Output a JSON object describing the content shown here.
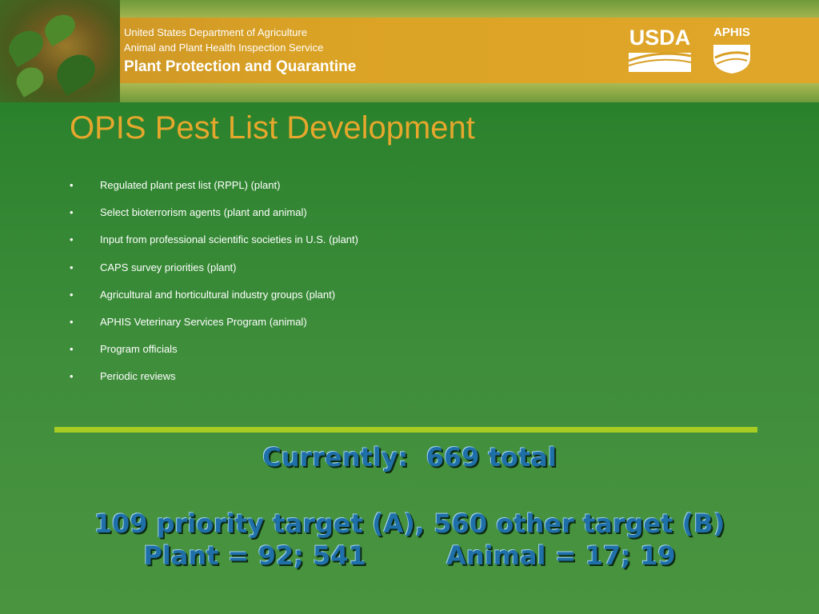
{
  "header": {
    "agency_line1": "United States Department of Agriculture",
    "agency_line2": "Animal and Plant Health Inspection Service",
    "program": "Plant Protection and Quarantine",
    "logo_usda": "USDA",
    "logo_aphis": "APHIS"
  },
  "slide": {
    "title": "OPIS Pest List Development",
    "bullet_marker": "•",
    "bullets": [
      "Regulated plant pest list (RPPL) (plant)",
      "Select bioterrorism agents (plant and animal)",
      "Input from professional scientific societies in U.S. (plant)",
      "CAPS survey priorities (plant)",
      "Agricultural and horticultural industry groups (plant)",
      "APHIS Veterinary Services Program (animal)",
      "Program officials",
      "Periodic reviews"
    ],
    "summary_line1": "Currently:  669 total",
    "summary_line2": "109 priority target (A), 560 other target (B)",
    "summary_line3": "Plant = 92; 541         Animal = 17; 19"
  },
  "colors": {
    "title": "#e6a72d",
    "summary_text": "#1f6fa8",
    "divider": "#a8cc22",
    "background": "#3a8a38",
    "header_band": "#d89f25"
  }
}
